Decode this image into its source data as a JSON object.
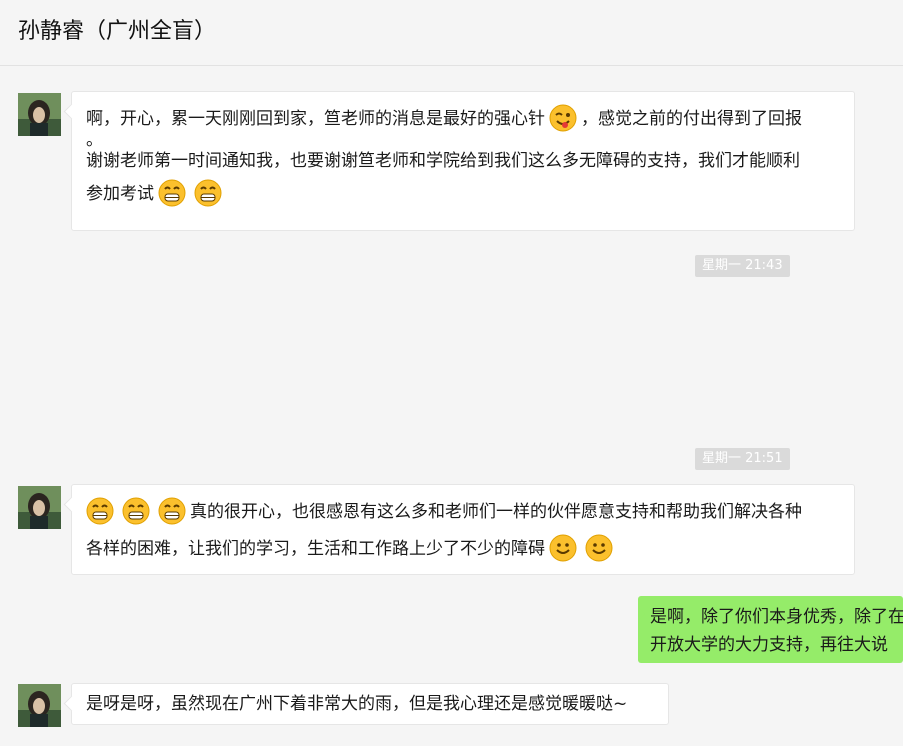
{
  "header": {
    "title": "孙静睿（广州全盲）"
  },
  "messages": [
    {
      "lines": [
        "啊，开心，累一天刚刚回到家，笪老师的消息是最好的强心针",
        "，感觉之前的付出得到了回报",
        "。",
        "谢谢老师第一时间通知我，也要谢谢笪老师和学院给到我们这么多无障碍的支持，我们才能顺利",
        "参加考试"
      ],
      "emojis": [
        "wink-tongue-emoji",
        "grin-emoji",
        "grin-emoji"
      ]
    },
    {
      "time": "星期一 21:43"
    },
    {
      "time": "星期一 21:51"
    },
    {
      "lines": [
        "真的很开心，也很感恩有这么多和老师们一样的伙伴愿意支持和帮助我们解决各种",
        "各样的困难，让我们的学习，生活和工作路上少了不少的障碍"
      ],
      "emojis": [
        "grin-emoji",
        "grin-emoji",
        "grin-emoji",
        "smile-emoji",
        "smile-emoji"
      ]
    },
    {
      "lines": [
        "是啊，除了你们本身优秀，除了在",
        "开放大学的大力支持，再往大说"
      ]
    },
    {
      "lines": [
        "是呀是呀，虽然现在广州下着非常大的雨，但是我心理还是感觉暖暖哒~"
      ]
    }
  ],
  "colors": {
    "background": "#f5f5f5",
    "incoming_bubble": "#ffffff",
    "outgoing_bubble": "#95ec69",
    "time_badge": "#dadada"
  }
}
